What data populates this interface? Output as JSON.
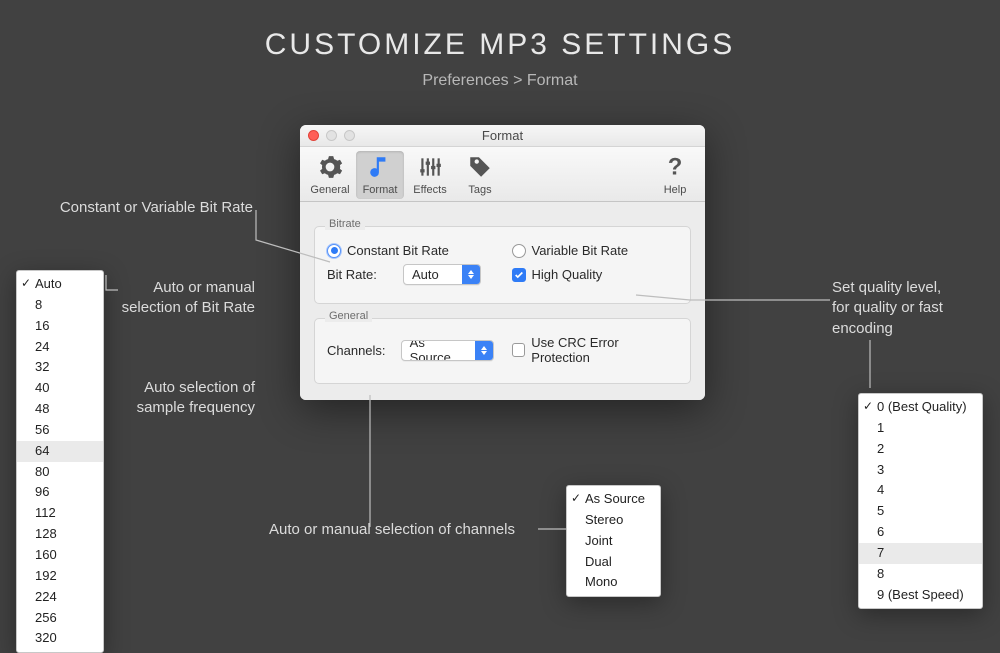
{
  "page": {
    "title": "CUSTOMIZE MP3 SETTINGS",
    "breadcrumb": "Preferences > Format"
  },
  "window": {
    "title": "Format",
    "toolbar": {
      "general": "General",
      "format": "Format",
      "effects": "Effects",
      "tags": "Tags",
      "help": "Help"
    },
    "bitrate_section": {
      "legend": "Bitrate",
      "constant_label": "Constant Bit Rate",
      "variable_label": "Variable Bit Rate",
      "bitrate_field_label": "Bit Rate:",
      "bitrate_value": "Auto",
      "high_quality_label": "High Quality"
    },
    "general_section": {
      "legend": "General",
      "channels_field_label": "Channels:",
      "channels_value": "As Source",
      "crc_label": "Use CRC Error Protection"
    }
  },
  "annotations": {
    "cbr_vbr": "Constant or Variable Bit Rate",
    "bitrate_sel": "Auto or manual\nselection of Bit Rate",
    "sample_freq": "Auto selection of\nsample frequency",
    "channels_sel": "Auto or manual selection of channels",
    "quality_level": "Set quality level,\nfor quality or fast\nencoding"
  },
  "bitrate_options": [
    "Auto",
    "8",
    "16",
    "24",
    "32",
    "40",
    "48",
    "56",
    "64",
    "80",
    "96",
    "112",
    "128",
    "160",
    "192",
    "224",
    "256",
    "320"
  ],
  "bitrate_selected": "Auto",
  "channel_options": [
    "As Source",
    "Stereo",
    "Joint",
    "Dual",
    "Mono"
  ],
  "channel_selected": "As Source",
  "quality_options": [
    "0 (Best Quality)",
    "1",
    "2",
    "3",
    "4",
    "5",
    "6",
    "7",
    "8",
    "9 (Best Speed)"
  ],
  "quality_selected": "0 (Best Quality)"
}
